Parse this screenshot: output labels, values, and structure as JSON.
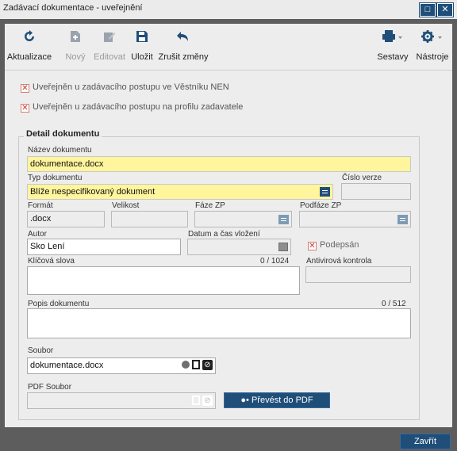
{
  "window": {
    "title": "Zadávací dokumentace - uveřejnění"
  },
  "toolbar": {
    "refresh": "Aktualizace",
    "new": "Nový",
    "edit": "Editovat",
    "save": "Uložit",
    "cancel": "Zrušit změny",
    "reports": "Sestavy",
    "tools": "Nástroje"
  },
  "checks": {
    "nen": "Uveřejněn u zadávacího postupu ve Věstníku NEN",
    "profile": "Uveřejněn u zadávacího postupu na profilu zadavatele"
  },
  "detail": {
    "legend": "Detail dokumentu",
    "name_label": "Název dokumentu",
    "name_value": "dokumentace.docx",
    "type_label": "Typ dokumentu",
    "type_value": "Blíže nespecifikovaný dokument",
    "version_label": "Číslo verze",
    "version_value": "",
    "format_label": "Formát",
    "format_value": ".docx",
    "size_label": "Velikost",
    "size_value": "",
    "phase_label": "Fáze ZP",
    "phase_value": "",
    "subphase_label": "Podfáze ZP",
    "subphase_value": "",
    "author_label": "Autor",
    "author_value": "Sko Lení",
    "date_label": "Datum a čas vložení",
    "date_value": "",
    "signed_label": "Podepsán",
    "keywords_label": "Klíčová slova",
    "keywords_counter": "0 / 1024",
    "keywords_value": "",
    "antivirus_label": "Antivirová kontrola",
    "antivirus_value": "",
    "description_label": "Popis dokumentu",
    "description_counter": "0 / 512",
    "description_value": "",
    "file_label": "Soubor",
    "file_value": "dokumentace.docx",
    "pdf_label": "PDF Soubor",
    "pdf_value": "",
    "convert_button": "Převést do PDF"
  },
  "footer": {
    "close": "Zavřít"
  },
  "colors": {
    "accent": "#1f4e79",
    "highlight": "#fff59d",
    "frame": "#5d5d5d"
  }
}
